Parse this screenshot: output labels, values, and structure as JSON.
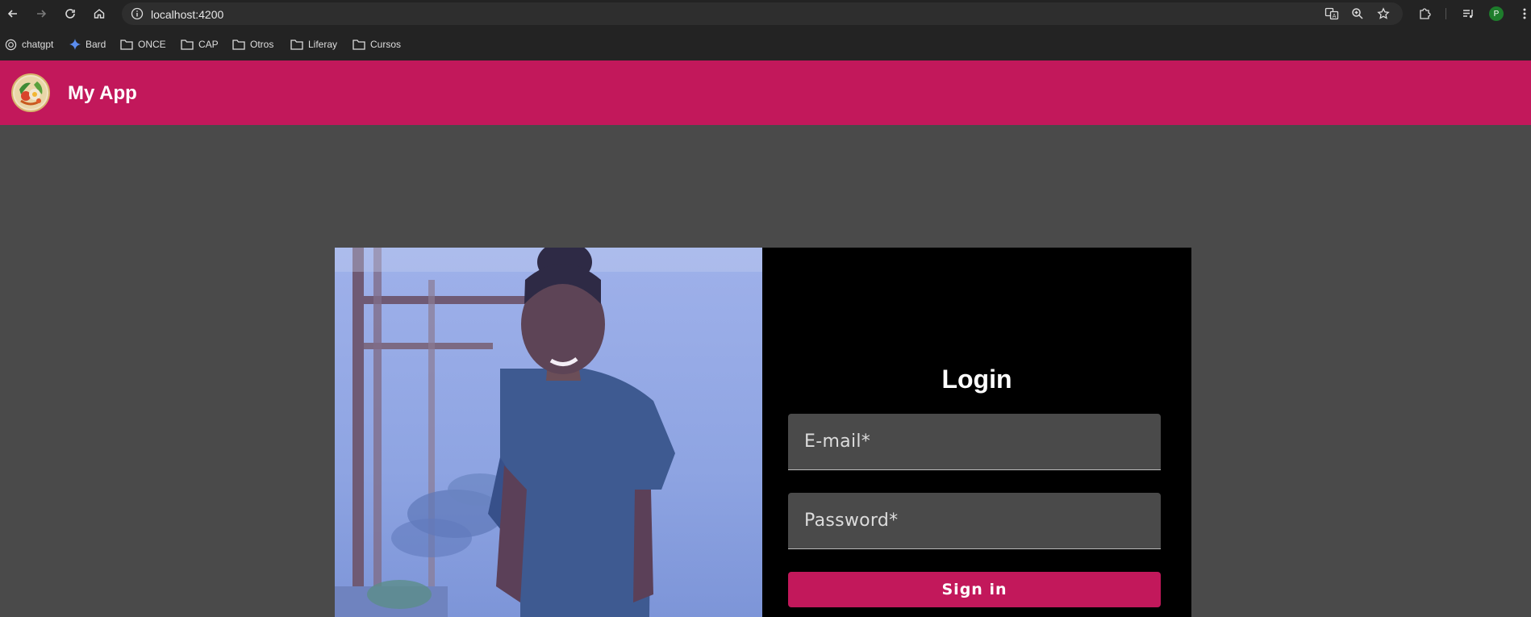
{
  "browser": {
    "url": "localhost:4200",
    "profile_initial": "P",
    "bookmarks": [
      {
        "label": "chatgpt",
        "icon": "chatgpt-icon"
      },
      {
        "label": "Bard",
        "icon": "bard-sparkle-icon"
      },
      {
        "label": "ONCE",
        "icon": "folder-icon"
      },
      {
        "label": "CAP",
        "icon": "folder-icon"
      },
      {
        "label": "Otros",
        "icon": "folder-icon"
      },
      {
        "label": "Liferay",
        "icon": "folder-icon"
      },
      {
        "label": "Cursos",
        "icon": "folder-icon"
      }
    ]
  },
  "app": {
    "title": "My App",
    "accent": "#c2185b"
  },
  "login": {
    "title": "Login",
    "email_placeholder": "E-mail*",
    "password_placeholder": "Password*",
    "submit_label": "Sign in"
  }
}
